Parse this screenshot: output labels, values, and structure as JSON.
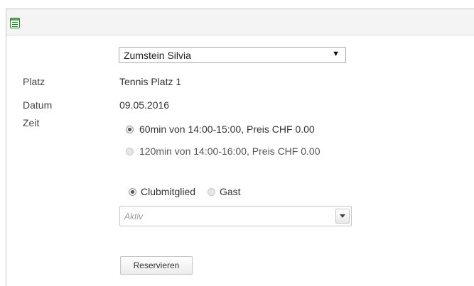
{
  "form": {
    "member_select": {
      "value": "Zumstein Silvia",
      "arrow": "▼"
    },
    "platz": {
      "label": "Platz",
      "value": "Tennis Platz 1"
    },
    "datum": {
      "label": "Datum",
      "value": "09.05.2016"
    },
    "zeit": {
      "label": "Zeit",
      "options": [
        {
          "label": "60min von 14:00-15:00, Preis CHF 0.00",
          "selected": true,
          "enabled": true
        },
        {
          "label": "120min von 14:00-16:00, Preis CHF 0.00",
          "selected": false,
          "enabled": false
        }
      ]
    },
    "player_type": {
      "options": [
        {
          "label": "Clubmitglied",
          "selected": true
        },
        {
          "label": "Gast",
          "selected": false
        }
      ]
    },
    "status_combo": {
      "placeholder": "Aktiv"
    },
    "submit_label": "Reservieren"
  },
  "icons": {
    "header": "form-icon"
  },
  "colors": {
    "header_bg": "#f4f4f4",
    "icon_green": "#2f7a2f",
    "border": "#c8c8c8"
  }
}
